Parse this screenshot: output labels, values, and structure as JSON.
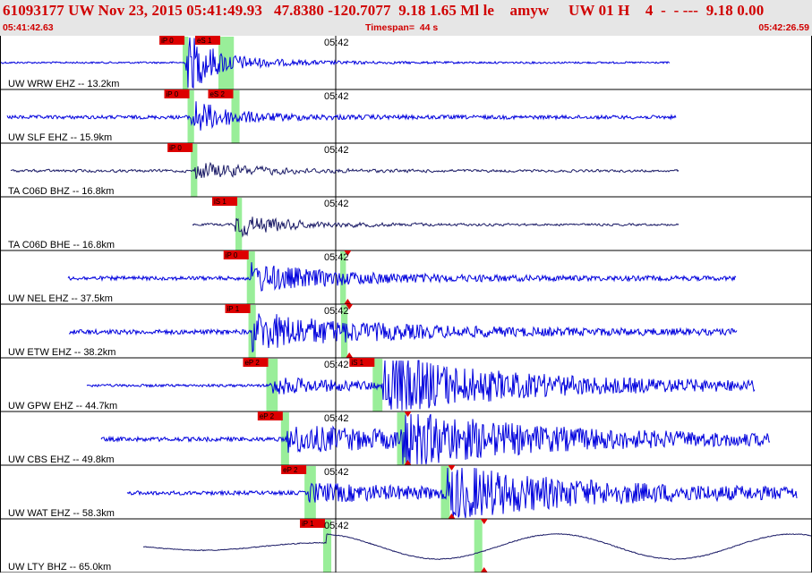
{
  "header": {
    "title": "61093177 UW Nov 23, 2015 05:41:49.93   47.8380 -120.7077  9.18 1.65 Ml le    amyw     UW 01 H    4  -  - ---  9.18 0.00",
    "start_time": "05:41:42.63",
    "timespan": "Timespan=  44 s",
    "end_time": "05:42:26.59"
  },
  "colors": {
    "header_text": "#d00000",
    "header_bg": "#e6e6e6",
    "trace_blue": "#0000dd",
    "trace_dark": "#1a1a66",
    "pick_bg": "#dd0000",
    "pick_band": "#99ee99"
  },
  "traces": [
    {
      "label": "UW WRW EHZ -- 13.2km",
      "tick": "05:42",
      "color": "#0000dd",
      "picks": [
        {
          "label": "iP 0",
          "band": [
            0.225,
            0.232
          ]
        },
        {
          "label": "eS 1",
          "band": [
            0.269,
            0.288
          ]
        }
      ]
    },
    {
      "label": "UW SLF EHZ -- 15.9km",
      "tick": "05:42",
      "color": "#0000dd",
      "picks": [
        {
          "label": "iP 0",
          "band": [
            0.231,
            0.239
          ]
        },
        {
          "label": "eS 2",
          "band": [
            0.285,
            0.295
          ]
        }
      ]
    },
    {
      "label": "TA C06D BHZ -- 16.8km",
      "tick": "05:42",
      "color": "#1a1a66",
      "picks": [
        {
          "label": "iP 0",
          "band": [
            0.235,
            0.243
          ]
        }
      ]
    },
    {
      "label": "TA C06D BHE -- 16.8km",
      "tick": "05:42",
      "color": "#1a1a66",
      "picks": [
        {
          "label": "iS 1",
          "band": [
            0.29,
            0.298
          ]
        }
      ]
    },
    {
      "label": "UW NEL EHZ -- 37.5km",
      "tick": "05:42",
      "color": "#0000dd",
      "picks": [
        {
          "label": "iP 0",
          "band": [
            0.304,
            0.314
          ]
        },
        {
          "label": "",
          "band": [
            0.419,
            0.426
          ]
        }
      ]
    },
    {
      "label": "UW ETW EHZ -- 38.2km",
      "tick": "05:42",
      "color": "#0000dd",
      "picks": [
        {
          "label": "iP 1",
          "band": [
            0.306,
            0.315
          ]
        },
        {
          "label": "",
          "band": [
            0.42,
            0.428
          ]
        }
      ]
    },
    {
      "label": "UW GPW EHZ -- 44.7km",
      "tick": "05:42",
      "color": "#0000dd",
      "picks": [
        {
          "label": "eP 2",
          "band": [
            0.328,
            0.342
          ]
        },
        {
          "label": "iS 1",
          "band": [
            0.459,
            0.471
          ]
        }
      ]
    },
    {
      "label": "UW CBS EHZ -- 49.8km",
      "tick": "05:42",
      "color": "#0000dd",
      "picks": [
        {
          "label": "eP 2",
          "band": [
            0.346,
            0.356
          ]
        },
        {
          "label": "",
          "band": [
            0.489,
            0.5
          ]
        }
      ]
    },
    {
      "label": "UW WAT EHZ -- 58.3km",
      "tick": "05:42",
      "color": "#0000dd",
      "picks": [
        {
          "label": "eP 2",
          "band": [
            0.375,
            0.389
          ]
        },
        {
          "label": "",
          "band": [
            0.543,
            0.554
          ]
        }
      ]
    },
    {
      "label": "UW LTY BHZ -- 65.0km",
      "tick": "05:42",
      "color": "#1a1a66",
      "picks": [
        {
          "label": "iP 1",
          "band": [
            0.398,
            0.408
          ]
        },
        {
          "label": "",
          "band": [
            0.584,
            0.594
          ]
        }
      ]
    }
  ]
}
